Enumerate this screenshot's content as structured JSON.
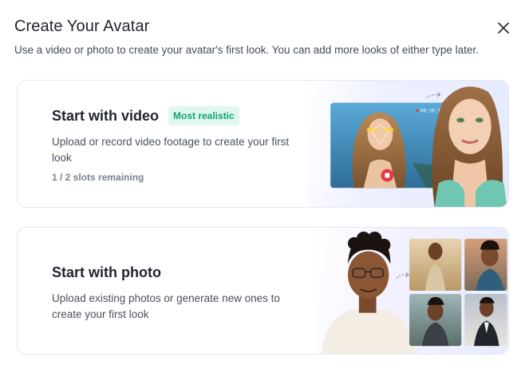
{
  "dialog": {
    "title": "Create Your Avatar",
    "subtitle": "Use a video or photo to create your avatar's first look. You can add more looks of either type later."
  },
  "video_option": {
    "title": "Start with video",
    "badge": "Most realistic",
    "description": "Upload or record video footage to create your first look",
    "slots": "1 / 2 slots remaining",
    "timer": "00:10:70 00"
  },
  "photo_option": {
    "title": "Start with photo",
    "description": "Upload existing photos or generate new ones to create your first look"
  },
  "colors": {
    "badge_bg": "#dff7ee",
    "badge_text": "#16a36f",
    "record_red": "#e53947"
  },
  "icons": {
    "close": "close-icon",
    "record": "record-icon",
    "arrow": "dashed-arrow-icon"
  }
}
